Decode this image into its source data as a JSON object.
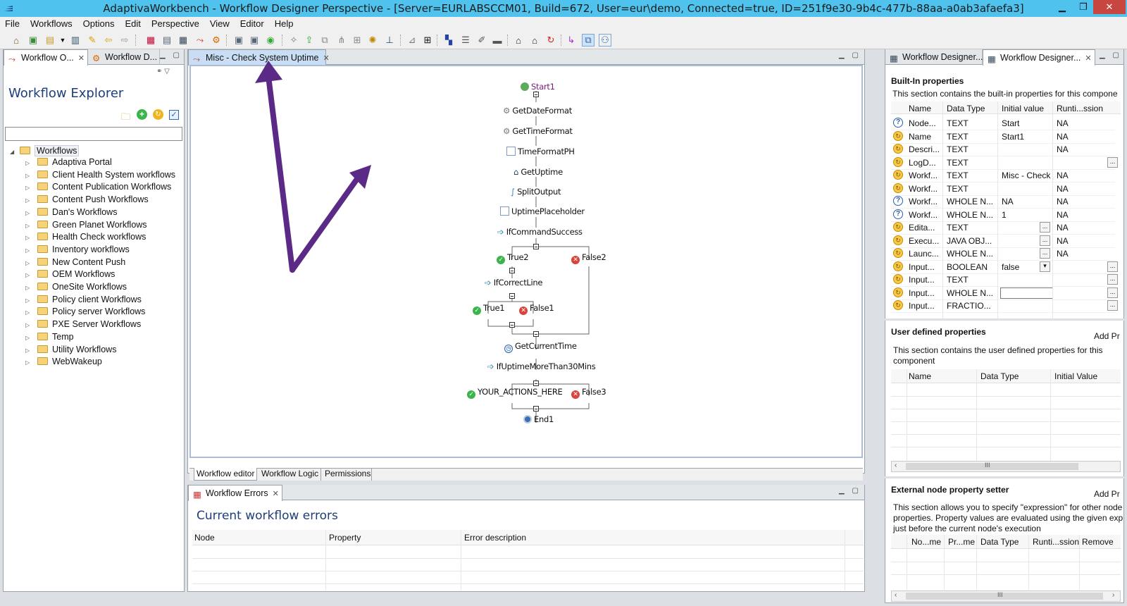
{
  "window": {
    "title": "AdaptivaWorkbench - Workflow Designer Perspective - [Server=EURLABSCCM01, Build=672, User=eur\\demo, Connected=true, ID=251f9e30-9b4c-477b-88aa-a0ab3afaefa3]"
  },
  "menu": [
    "File",
    "Workflows",
    "Options",
    "Edit",
    "Perspective",
    "View",
    "Editor",
    "Help"
  ],
  "left": {
    "tabs": [
      "Workflow O...",
      "Workflow D..."
    ],
    "title": "Workflow Explorer",
    "search_value": "",
    "root": "Workflows",
    "folders": [
      "Adaptiva Portal",
      "Client Health System workflows",
      "Content Publication Workflows",
      "Content Push Workflows",
      "Dan's Workflows",
      "Green Planet Workflows",
      "Health Check workflows",
      "Inventory workflows",
      "New Content Push",
      "OEM Workflows",
      "OneSite Workflows",
      "Policy client Workflows",
      "Policy server Workflows",
      "PXE Server Workflows",
      "Temp",
      "Utility Workflows",
      "WebWakeup"
    ]
  },
  "editor": {
    "tab": "Misc - Check System Uptime",
    "nodes": {
      "start1": "Start1",
      "getdateformat": "GetDateFormat",
      "gettimeformat": "GetTimeFormat",
      "timeformatph": "TimeFormatPH",
      "getuptime": "GetUptime",
      "splitoutput": "SplitOutput",
      "uptimeplaceholder": "UptimePlaceholder",
      "ifcommandsuccess": "IfCommandSuccess",
      "true2": "True2",
      "false2": "False2",
      "ifcorrectline": "IfCorrectLine",
      "true1": "True1",
      "false1": "False1",
      "getcurrenttime": "GetCurrentTime",
      "ifuptimemore": "IfUptimeMoreThan30Mins",
      "youractions": "YOUR_ACTIONS_HERE",
      "false3": "False3",
      "end1": "End1"
    },
    "bottom_tabs": [
      "Workflow editor",
      "Workflow Logic",
      "Permissions"
    ]
  },
  "errors": {
    "tab": "Workflow Errors",
    "title": "Current workflow errors",
    "columns": [
      "Node",
      "Property",
      "Error description"
    ]
  },
  "right": {
    "tabs": [
      "Workflow Designer...",
      "Workflow Designer..."
    ],
    "builtin": {
      "title": "Built-In properties",
      "desc": "This section contains the built-in properties for this compone",
      "columns": [
        "Name",
        "Data Type",
        "Initial value",
        "Runti...ssion"
      ],
      "rows": [
        [
          "Node...",
          "TEXT",
          "Start",
          "NA"
        ],
        [
          "Name",
          "TEXT",
          "Start1",
          "NA"
        ],
        [
          "Descri...",
          "TEXT",
          "",
          "NA"
        ],
        [
          "LogD...",
          "TEXT",
          "",
          ""
        ],
        [
          "Workf...",
          "TEXT",
          "Misc - Check",
          "NA"
        ],
        [
          "Workf...",
          "TEXT",
          "",
          "NA"
        ],
        [
          "Workf...",
          "WHOLE N...",
          "NA",
          "NA"
        ],
        [
          "Workf...",
          "WHOLE N...",
          "1",
          "NA"
        ],
        [
          "Edita...",
          "TEXT",
          "",
          "NA"
        ],
        [
          "Execu...",
          "JAVA OBJ...",
          "",
          "NA"
        ],
        [
          "Launc...",
          "WHOLE N...",
          "",
          "NA"
        ],
        [
          "Input...",
          "BOOLEAN",
          "false",
          ""
        ],
        [
          "Input...",
          "TEXT",
          "",
          ""
        ],
        [
          "Input...",
          "WHOLE N...",
          "",
          ""
        ],
        [
          "Input...",
          "FRACTIO...",
          "",
          ""
        ]
      ]
    },
    "userdef": {
      "title": "User defined properties",
      "add": "Add Pr",
      "desc1": "This section contains the user defined properties for this",
      "desc2": "component",
      "columns": [
        "Name",
        "Data Type",
        "Initial Value"
      ]
    },
    "external": {
      "title": "External node property setter",
      "add": "Add Pr",
      "desc1": "This section allows you to specify \"expression\" for other node",
      "desc2": "properties. Property values are evaluated using the given expr",
      "desc3": "just before the current node's execution",
      "columns": [
        "No...me",
        "Pr...me",
        "Data Type",
        "Runti...ssion",
        "Remove"
      ]
    },
    "scroll_glyph": "III"
  },
  "colors": {
    "accent": "#4fc3ee",
    "title_blue": "#1d3f78",
    "arrow": "#5b2a86"
  }
}
